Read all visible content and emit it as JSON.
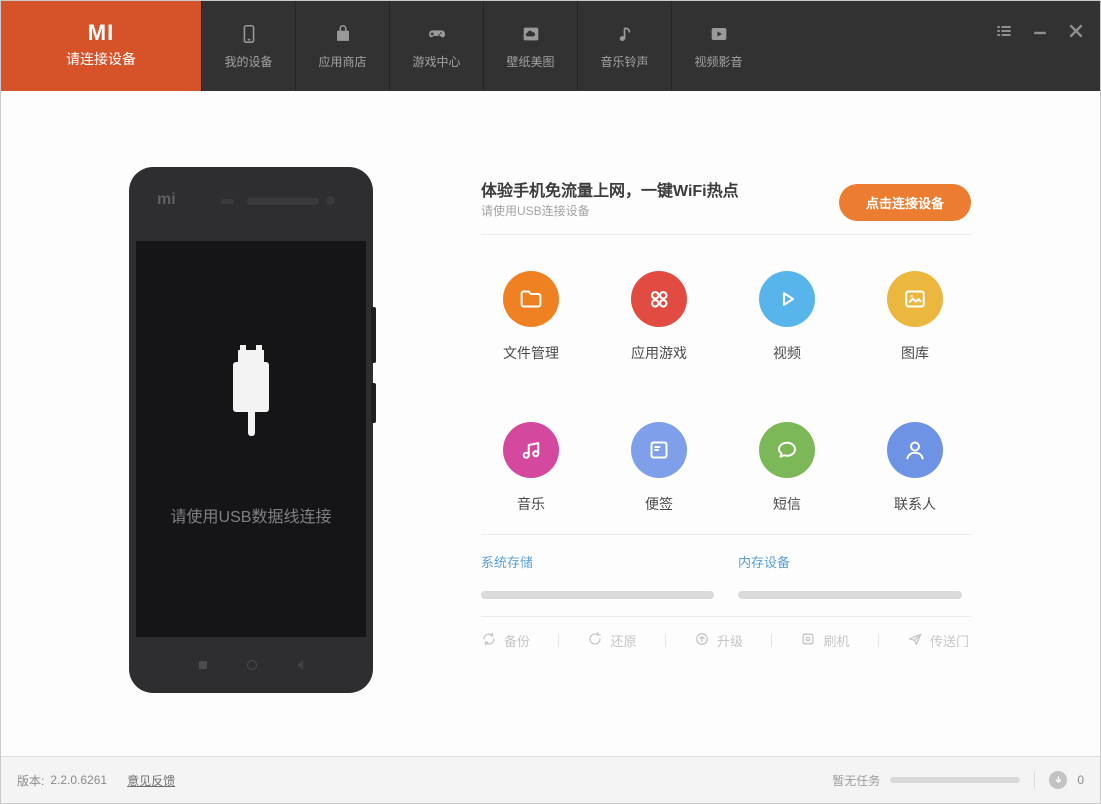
{
  "navbar": {
    "active_tab": {
      "logo": "MI",
      "label": "请连接设备"
    },
    "tabs": [
      {
        "label": "我的设备",
        "icon": "phone-icon"
      },
      {
        "label": "应用商店",
        "icon": "shopping-bag-icon"
      },
      {
        "label": "游戏中心",
        "icon": "gamepad-icon"
      },
      {
        "label": "壁纸美图",
        "icon": "wallpaper-icon"
      },
      {
        "label": "音乐铃声",
        "icon": "music-note-icon"
      },
      {
        "label": "视频影音",
        "icon": "video-icon"
      }
    ],
    "window_controls": [
      "task-list-icon",
      "minimize-icon",
      "close-icon"
    ]
  },
  "phone_panel": {
    "brand_logo": "mi",
    "message": "请使用USB数据线连接"
  },
  "connect_section": {
    "headline": "体验手机免流量上网，一键WiFi热点",
    "subtext": "请使用USB连接设备",
    "button_label": "点击连接设备",
    "button_color": "#ec7c30"
  },
  "shortcuts": [
    {
      "label": "文件管理",
      "icon": "folder-icon",
      "color": "#f08123"
    },
    {
      "label": "应用游戏",
      "icon": "apps-grid-icon",
      "color": "#e14b41"
    },
    {
      "label": "视频",
      "icon": "play-icon",
      "color": "#58b5ec"
    },
    {
      "label": "图库",
      "icon": "gallery-icon",
      "color": "#ecb73f"
    },
    {
      "label": "音乐",
      "icon": "music-notes-icon",
      "color": "#d4489d"
    },
    {
      "label": "便签",
      "icon": "note-icon",
      "color": "#7f9fea"
    },
    {
      "label": "短信",
      "icon": "chat-bubble-icon",
      "color": "#7cb857"
    },
    {
      "label": "联系人",
      "icon": "person-icon",
      "color": "#6e93e4"
    }
  ],
  "storage": [
    {
      "label": "系统存储"
    },
    {
      "label": "内存设备"
    }
  ],
  "tools": [
    {
      "label": "备份",
      "icon": "backup-icon"
    },
    {
      "label": "还原",
      "icon": "restore-icon"
    },
    {
      "label": "升级",
      "icon": "upgrade-icon"
    },
    {
      "label": "刷机",
      "icon": "flash-rom-icon"
    },
    {
      "label": "传送门",
      "icon": "portal-icon"
    }
  ],
  "footer": {
    "version_label": "版本:",
    "version": "2.2.0.6261",
    "feedback_link": "意见反馈",
    "task_status": "暂无任务",
    "download_count": "0"
  },
  "colors": {
    "accent_orange": "#d6532a",
    "topbar_bg": "#323232",
    "link_blue": "#5a9fd4"
  }
}
